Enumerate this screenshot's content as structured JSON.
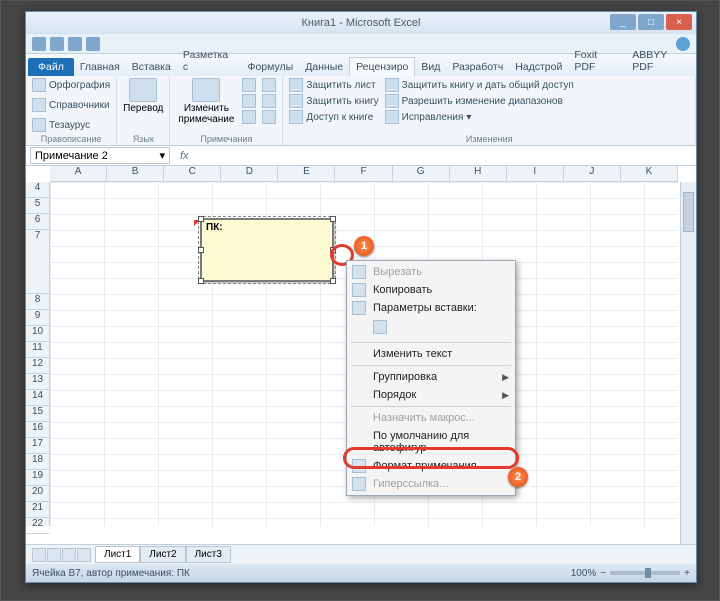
{
  "window": {
    "title": "Книга1 - Microsoft Excel",
    "controls": {
      "min": "_",
      "max": "□",
      "close": "×"
    }
  },
  "tabs": {
    "file": "Файл",
    "items": [
      "Главная",
      "Вставка",
      "Разметка с",
      "Формулы",
      "Данные",
      "Рецензиро",
      "Вид",
      "Разработч",
      "Надстрой",
      "Foxit PDF",
      "ABBYY PDF"
    ]
  },
  "ribbon": {
    "spelling": {
      "items": [
        "Орфография",
        "Справочники",
        "Тезаурус"
      ],
      "label": "Правописание"
    },
    "lang": {
      "btn": "Перевод",
      "label": "Язык"
    },
    "comment": {
      "btn": "Изменить примечание",
      "label": "Примечания"
    },
    "protect": {
      "items": [
        "Защитить лист",
        "Защитить книгу",
        "Доступ к книге"
      ],
      "share": "Защитить книгу и дать общий доступ",
      "range": "Разрешить изменение диапазонов",
      "fix": "Исправления",
      "label": "Изменения"
    }
  },
  "formula": {
    "name": "Примечание 2",
    "fx": "fx"
  },
  "columns": [
    "A",
    "B",
    "C",
    "D",
    "E",
    "F",
    "G",
    "H",
    "I",
    "J",
    "K"
  ],
  "rows": [
    "4",
    "5",
    "6",
    "7",
    "8",
    "9",
    "10",
    "11",
    "12",
    "13",
    "14",
    "15",
    "16",
    "17",
    "18",
    "19",
    "20",
    "21",
    "22"
  ],
  "comment_text": "ПК:",
  "badges": {
    "b1": "1",
    "b2": "2"
  },
  "context_menu": {
    "cut": "Вырезать",
    "copy": "Копировать",
    "paste_opts": "Параметры вставки:",
    "edit_text": "Изменить текст",
    "group": "Группировка",
    "order": "Порядок",
    "macro": "Назначить макрос...",
    "default": "По умолчанию для автофигур",
    "format": "Формат примечания...",
    "link": "Гиперссылка..."
  },
  "sheets": {
    "tabs": [
      "Лист1",
      "Лист2",
      "Лист3"
    ]
  },
  "status": {
    "text": "Ячейка B7, автор примечания: ПК",
    "zoom": "100%",
    "minus": "−",
    "plus": "+"
  }
}
